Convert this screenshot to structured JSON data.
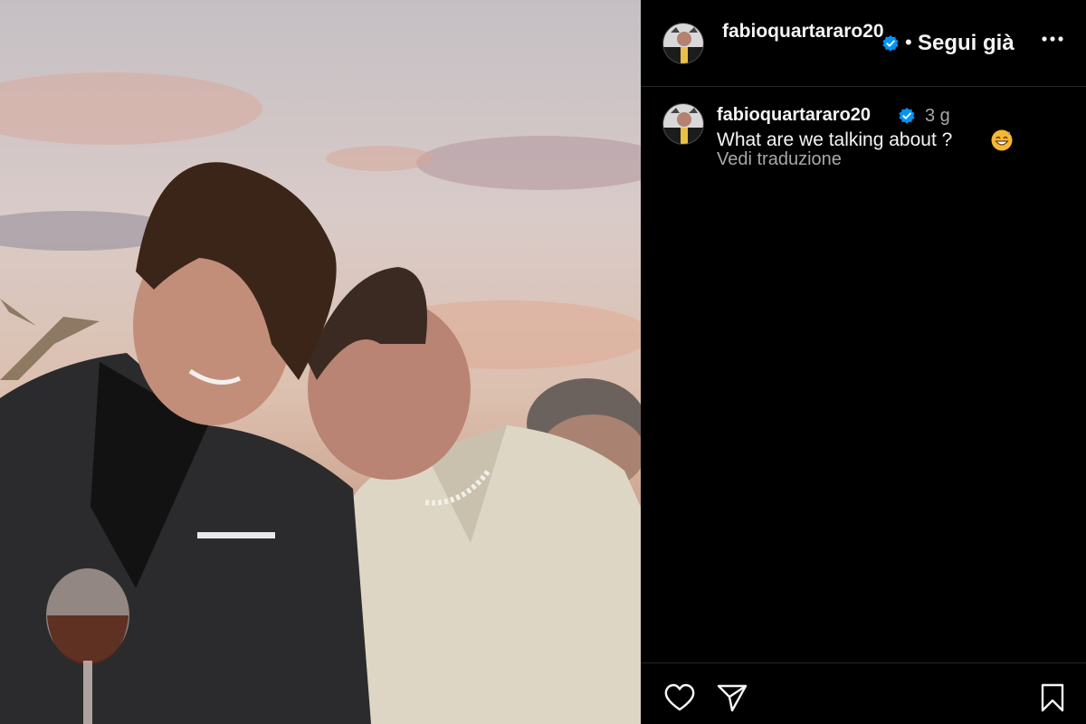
{
  "post": {
    "photo_description_icon": "photo-image",
    "header": {
      "username": "fabioquartararo20",
      "separator": "•",
      "follow_label": "Segui già",
      "more_icon": "more-horizontal-icon"
    },
    "caption": {
      "username": "fabioquartararo20",
      "time_ago": "3 g",
      "text": "What are we talking about ?",
      "emoji": "grinning-sweat-emoji",
      "translate_label": "Vedi traduzione"
    },
    "actions": {
      "like_icon": "heart-icon",
      "share_icon": "send-icon",
      "save_icon": "bookmark-icon"
    }
  },
  "colors": {
    "background": "#000000",
    "text_primary": "#f5f5f5",
    "text_secondary": "#a8a8a8",
    "verified_badge": "#0095f6",
    "divider": "#262626"
  }
}
